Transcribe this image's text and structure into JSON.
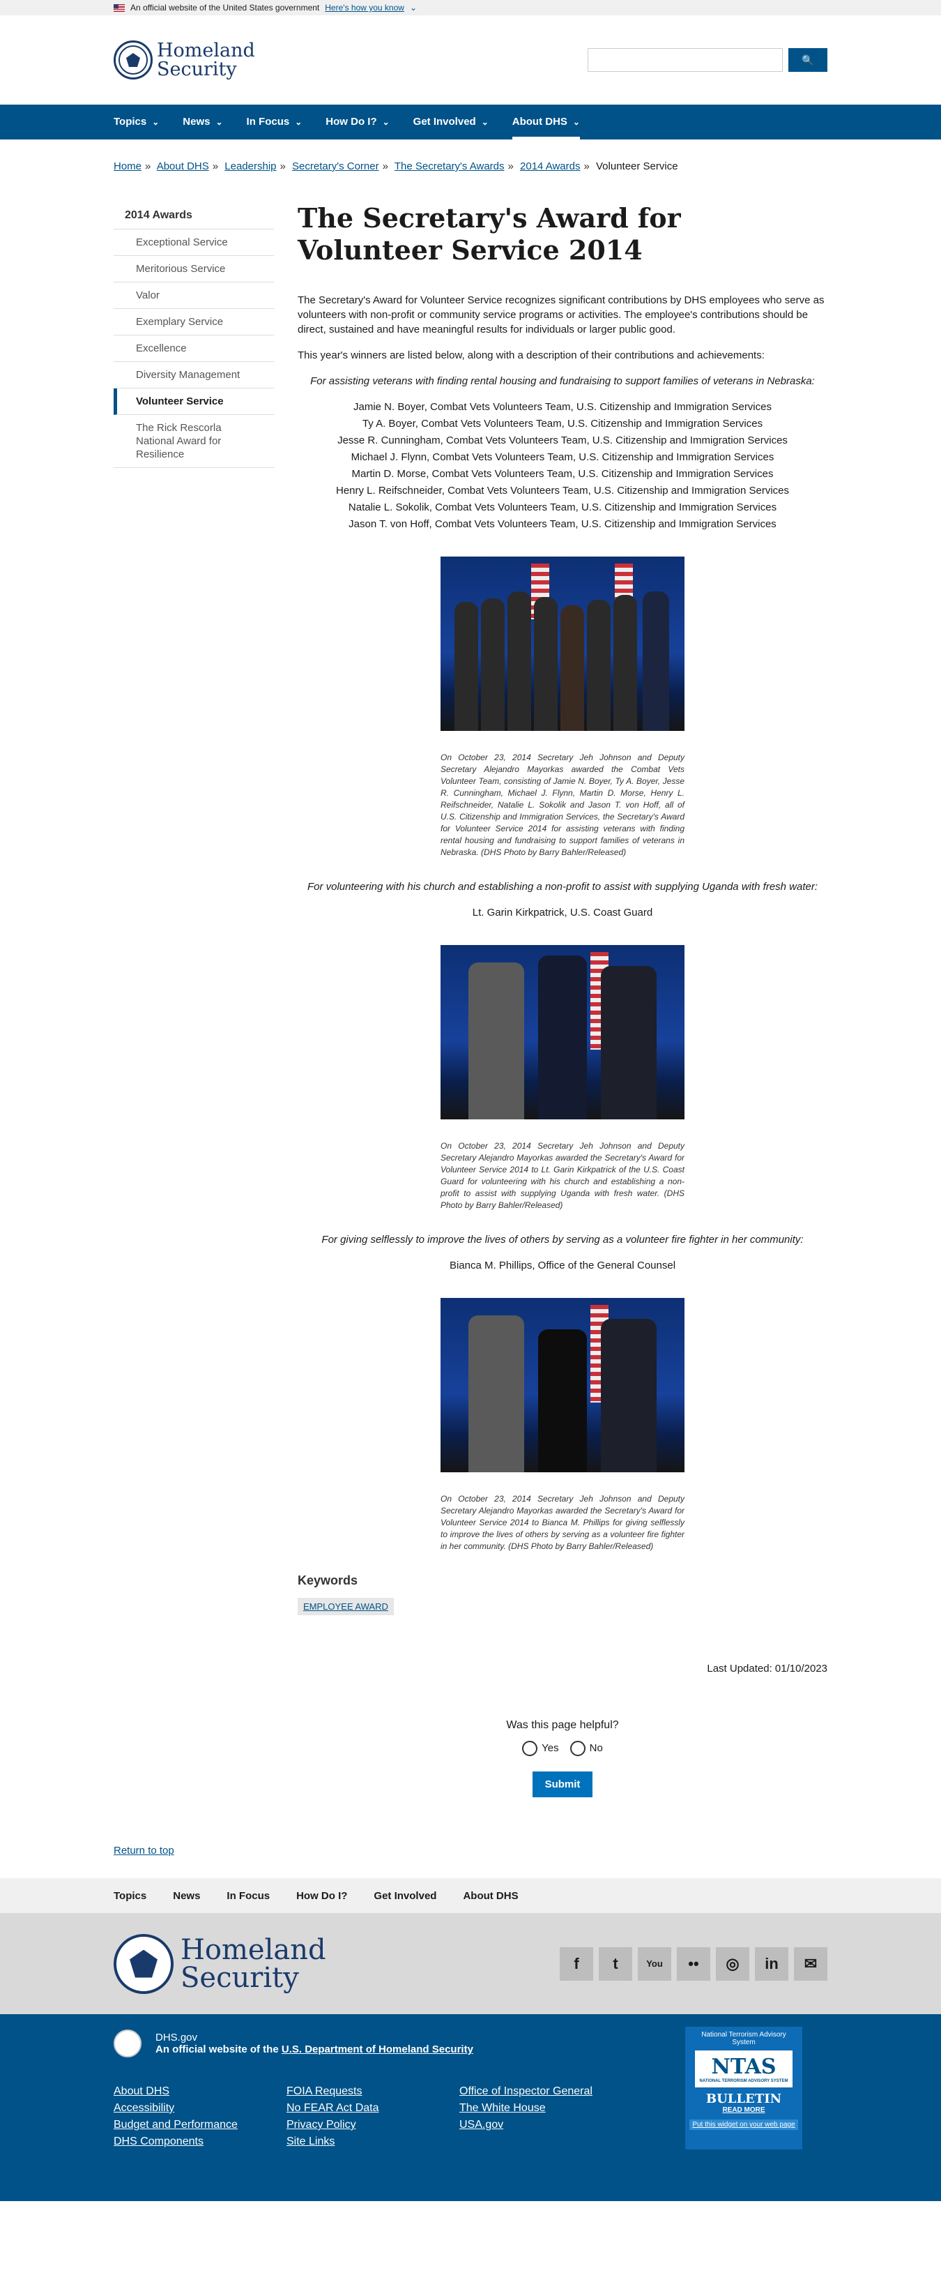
{
  "gov_banner": {
    "text": "An official website of the United States government",
    "link": "Here's how you know"
  },
  "header": {
    "logo_line1": "Homeland",
    "logo_line2": "Security",
    "search_placeholder": "",
    "search_button": "🔍"
  },
  "nav": {
    "items": [
      "Topics",
      "News",
      "In Focus",
      "How Do I?",
      "Get Involved",
      "About DHS"
    ],
    "active_index": 5
  },
  "breadcrumb": {
    "items": [
      "Home",
      "About DHS",
      "Leadership",
      "Secretary's Corner",
      "The Secretary's Awards",
      "2014 Awards"
    ],
    "current": "Volunteer Service"
  },
  "sidenav": {
    "heading": "2014 Awards",
    "items": [
      "Exceptional Service",
      "Meritorious Service",
      "Valor",
      "Exemplary Service",
      "Excellence",
      "Diversity Management",
      "Volunteer Service",
      "The Rick Rescorla National Award for Resilience"
    ],
    "active_index": 6
  },
  "content": {
    "title": "The Secretary's Award for Volunteer Service 2014",
    "intro": "The Secretary's Award for Volunteer Service recognizes significant contributions by DHS employees who serve as volunteers with non-profit or community service programs or activities. The employee's contributions should be direct, sustained and have meaningful results for individuals or larger public good.",
    "intro2": "This year's winners are listed below, along with a description of their contributions and achievements:",
    "awards": [
      {
        "heading": "For assisting veterans with finding rental housing and fundraising to support families of veterans in Nebraska:",
        "names": [
          "Jamie N. Boyer, Combat Vets Volunteers Team, U.S. Citizenship and Immigration Services",
          "Ty A. Boyer, Combat Vets Volunteers Team, U.S. Citizenship and Immigration Services",
          "Jesse R. Cunningham, Combat Vets Volunteers Team, U.S. Citizenship and Immigration Services",
          "Michael J. Flynn, Combat Vets Volunteers Team, U.S. Citizenship and Immigration Services",
          "Martin D. Morse, Combat Vets Volunteers Team, U.S. Citizenship and Immigration Services",
          "Henry L. Reifschneider, Combat Vets Volunteers Team, U.S. Citizenship and Immigration Services",
          "Natalie L. Sokolik, Combat Vets Volunteers Team, U.S. Citizenship and Immigration Services",
          "Jason T. von Hoff, Combat Vets Volunteers Team, U.S. Citizenship and Immigration Services"
        ],
        "caption": "On October 23, 2014 Secretary Jeh Johnson and Deputy Secretary Alejandro Mayorkas awarded the Combat Vets Volunteer Team, consisting of Jamie N. Boyer, Ty A. Boyer, Jesse R. Cunningham, Michael J. Flynn, Martin D. Morse, Henry L. Reifschneider, Natalie L. Sokolik and Jason T. von Hoff, all of U.S. Citizenship and Immigration Services, the Secretary's Award for Volunteer Service 2014 for assisting veterans with finding rental housing and fundraising to support families of veterans in Nebraska. (DHS Photo by Barry Bahler/Released)"
      },
      {
        "heading": "For volunteering with his church and establishing a non-profit to assist with supplying Uganda with fresh water:",
        "names": [
          "Lt. Garin Kirkpatrick, U.S. Coast Guard"
        ],
        "caption": "On October 23, 2014 Secretary Jeh Johnson and Deputy Secretary Alejandro Mayorkas awarded the Secretary's Award for Volunteer Service 2014 to Lt. Garin Kirkpatrick of the U.S. Coast Guard for volunteering with his church and establishing a non-profit to assist with supplying Uganda with fresh water. (DHS Photo by Barry Bahler/Released)"
      },
      {
        "heading": "For giving selflessly to improve the lives of others by serving as a volunteer fire fighter in her community:",
        "names": [
          "Bianca M. Phillips, Office of the General Counsel"
        ],
        "caption": "On October 23, 2014 Secretary Jeh Johnson and Deputy Secretary Alejandro Mayorkas awarded the Secretary's Award for Volunteer Service 2014 to Bianca M. Phillips for giving selflessly to improve the lives of others by serving as a volunteer fire fighter in her community. (DHS Photo by Barry Bahler/Released)"
      }
    ],
    "keywords_heading": "Keywords",
    "keyword": "EMPLOYEE AWARD",
    "last_updated": "Last Updated: 01/10/2023"
  },
  "feedback": {
    "question": "Was this page helpful?",
    "yes": "Yes",
    "no": "No",
    "submit": "Submit"
  },
  "return_to_top": "Return to top",
  "footer_nav": [
    "Topics",
    "News",
    "In Focus",
    "How Do I?",
    "Get Involved",
    "About DHS"
  ],
  "footer_logo": {
    "line1": "Homeland",
    "line2": "Security"
  },
  "social_icons": [
    "facebook-icon",
    "twitter-icon",
    "youtube-icon",
    "flickr-icon",
    "instagram-icon",
    "linkedin-icon",
    "email-icon"
  ],
  "footer": {
    "site": "DHS.gov",
    "official_prefix": "An official website of the",
    "official_link": "U.S. Department of Homeland Security",
    "links": [
      "About DHS",
      "FOIA Requests",
      "Office of Inspector General",
      "Accessibility",
      "No FEAR Act Data",
      "The White House",
      "Budget and Performance",
      "Privacy Policy",
      "USA.gov",
      "DHS Components",
      "Site Links"
    ],
    "ntas": {
      "title": "National Terrorism Advisory System",
      "logo": "NTAS",
      "subtitle": "NATIONAL TERRORISM ADVISORY SYSTEM",
      "bulletin": "BULLETIN",
      "read_more": "READ MORE",
      "widget": "Put this widget on your web page"
    }
  },
  "colors": {
    "primary": "#005288",
    "submit": "#0071bb",
    "footer_bg": "#005288",
    "nav_bg": "#005288"
  }
}
